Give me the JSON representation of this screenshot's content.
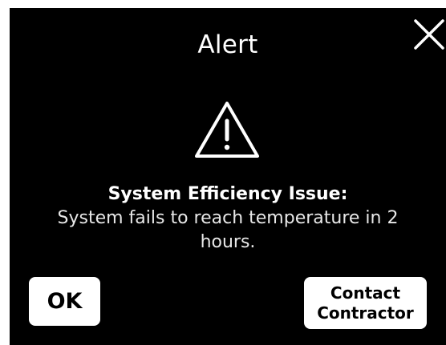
{
  "dialog": {
    "title": "Alert",
    "close_icon": "close-icon",
    "warning_icon": "warning-triangle-icon",
    "message_heading": "System Efficiency Issue:",
    "message_body": "System fails to reach temperature in 2 hours.",
    "ok_label": "OK",
    "contact_label": "Contact Contractor",
    "background_color": "#000000",
    "text_color": "#ffffff",
    "button_color": "#ffffff"
  }
}
